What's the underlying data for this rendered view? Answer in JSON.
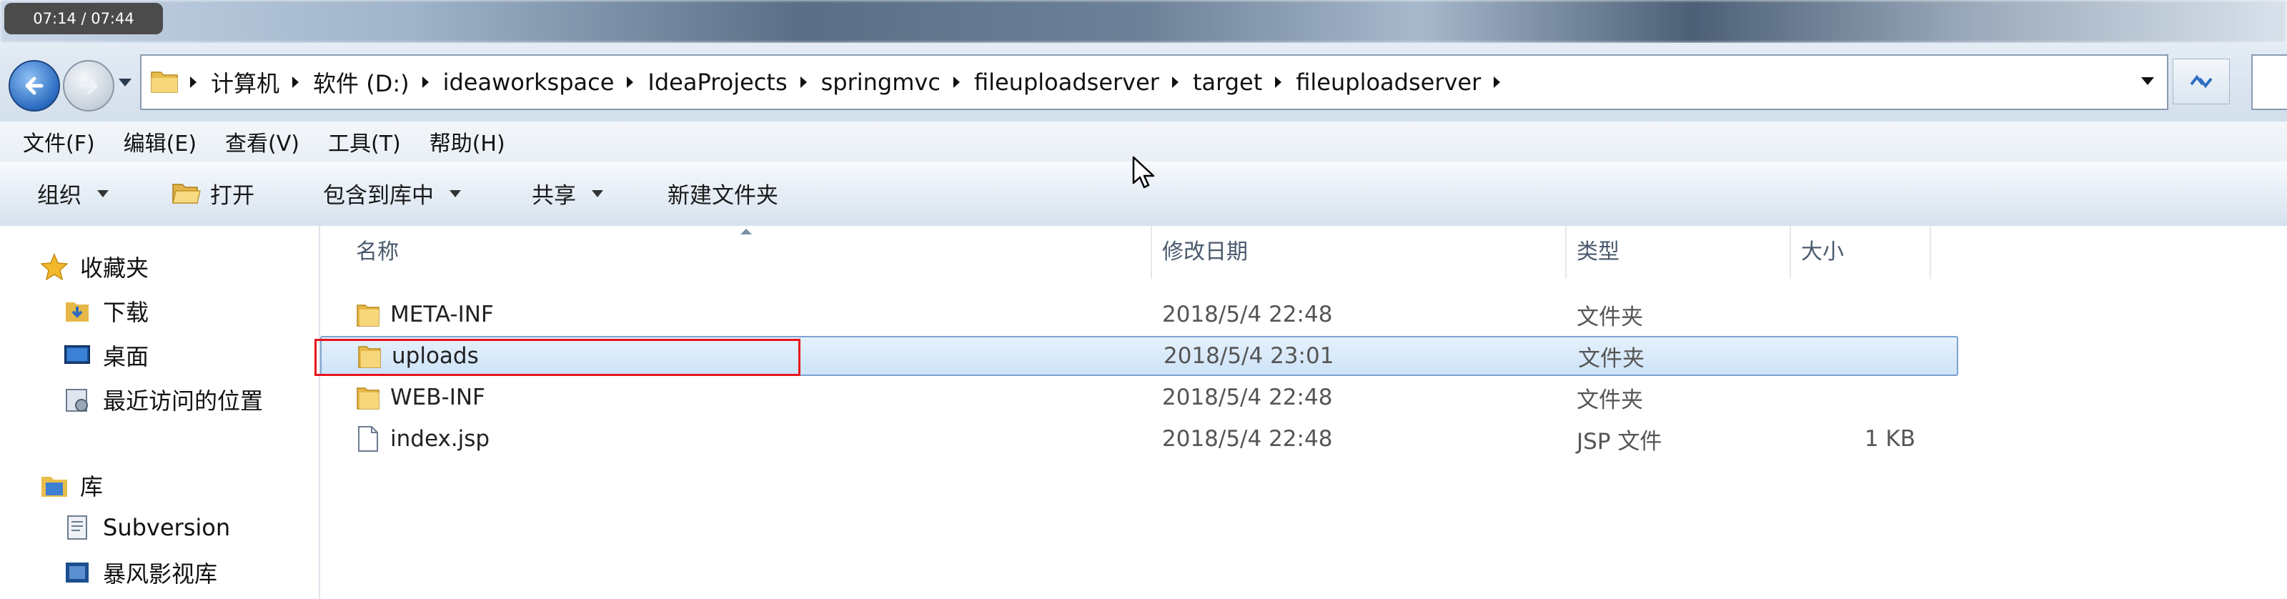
{
  "video": {
    "time": "07:14 / 07:44"
  },
  "address": {
    "crumbs": [
      "计算机",
      "软件 (D:)",
      "ideaworkspace",
      "IdeaProjects",
      "springmvc",
      "fileuploadserver",
      "target",
      "fileuploadserver"
    ]
  },
  "menu": [
    "文件(F)",
    "编辑(E)",
    "查看(V)",
    "工具(T)",
    "帮助(H)"
  ],
  "toolbar": {
    "organize": "组织",
    "open": "打开",
    "include_library": "包含到库中",
    "share": "共享",
    "new_folder": "新建文件夹"
  },
  "nav": {
    "favorites": "收藏夹",
    "downloads": "下载",
    "desktop": "桌面",
    "recent": "最近访问的位置",
    "libraries": "库",
    "subversion": "Subversion",
    "storm": "暴风影视库"
  },
  "columns": {
    "name": "名称",
    "modified": "修改日期",
    "type": "类型",
    "size": "大小"
  },
  "files": [
    {
      "name": "META-INF",
      "modified": "2018/5/4 22:48",
      "type": "文件夹",
      "size": "",
      "icon": "folder-icon"
    },
    {
      "name": "uploads",
      "modified": "2018/5/4 23:01",
      "type": "文件夹",
      "size": "",
      "icon": "folder-icon",
      "selected": true
    },
    {
      "name": "WEB-INF",
      "modified": "2018/5/4 22:48",
      "type": "文件夹",
      "size": "",
      "icon": "folder-icon"
    },
    {
      "name": "index.jsp",
      "modified": "2018/5/4 22:48",
      "type": "JSP 文件",
      "size": "1 KB",
      "icon": "file-icon"
    }
  ],
  "colors": {
    "selection": "#cde3f8",
    "highlight_box": "#e8141d",
    "toolbar_bg": "#e3ebf4"
  }
}
